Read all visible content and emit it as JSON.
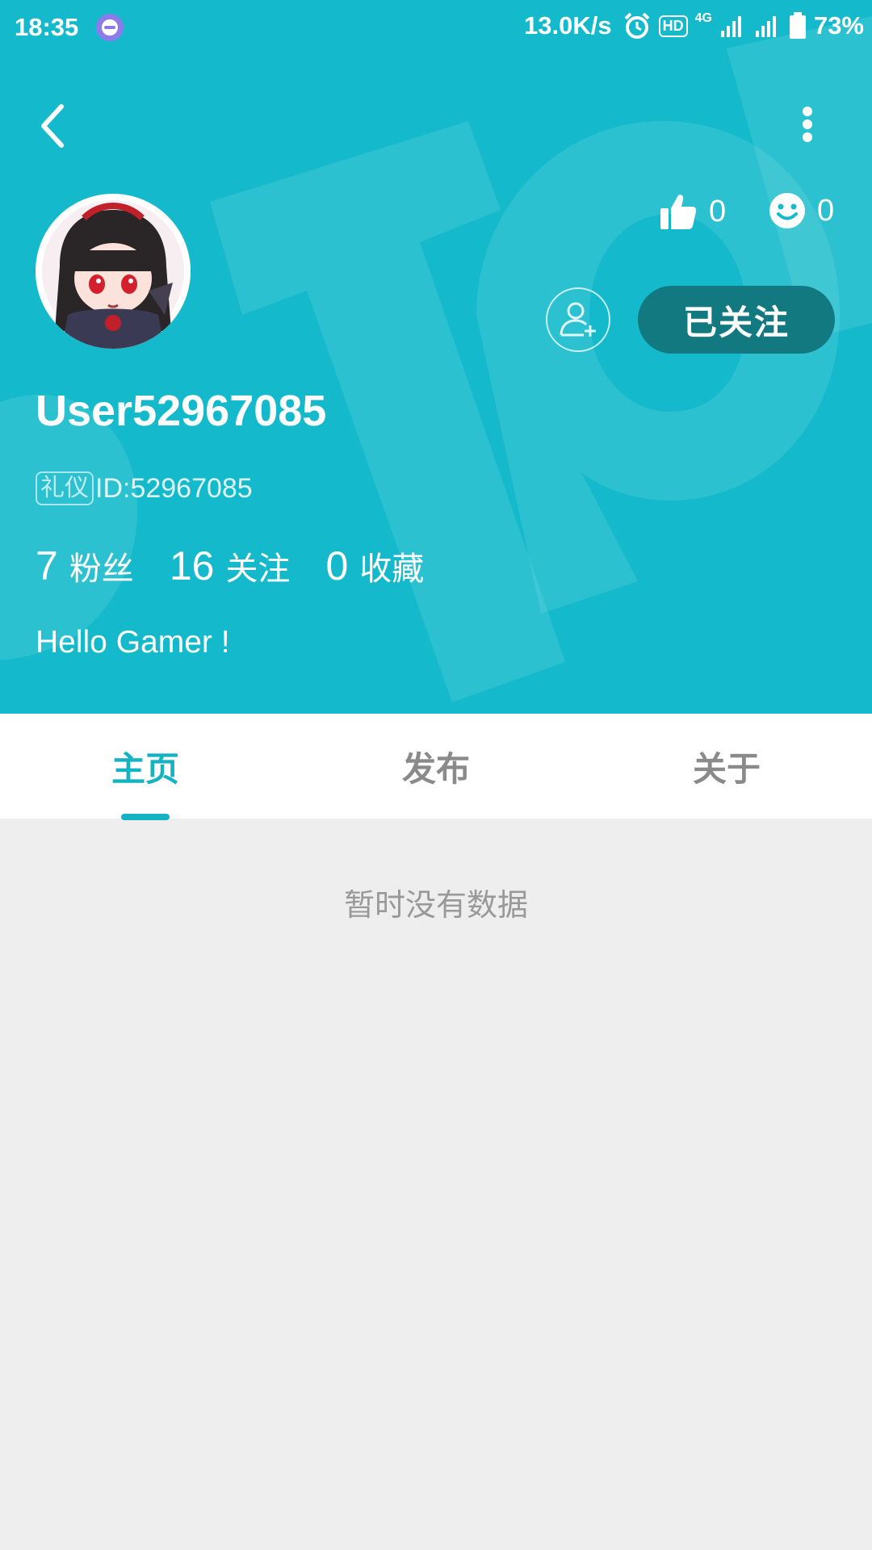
{
  "status_bar": {
    "time": "18:35",
    "net_speed": "13.0K/s",
    "hd_label": "HD",
    "network_label": "4G",
    "battery": "73%"
  },
  "profile": {
    "likes_count": "0",
    "smiles_count": "0",
    "follow_button_label": "已关注",
    "username": "User52967085",
    "badge_label": "礼仪",
    "id_text": "ID:52967085",
    "stats": [
      {
        "number": "7",
        "label": "粉丝"
      },
      {
        "number": "16",
        "label": "关注"
      },
      {
        "number": "0",
        "label": "收藏"
      }
    ],
    "bio": "Hello Gamer !"
  },
  "tabs": [
    {
      "label": "主页",
      "active": true
    },
    {
      "label": "发布",
      "active": false
    },
    {
      "label": "关于",
      "active": false
    }
  ],
  "empty_message": "暂时没有数据",
  "colors": {
    "header_bg": "#14bacb",
    "accent": "#14b3c4",
    "follow_button_bg": "#137980",
    "page_bg": "#eeeeee"
  },
  "icons": [
    "back-arrow-icon",
    "more-vertical-icon",
    "thumbs-up-icon",
    "smile-icon",
    "add-user-icon",
    "alarm-icon",
    "signal-icon",
    "battery-icon"
  ]
}
